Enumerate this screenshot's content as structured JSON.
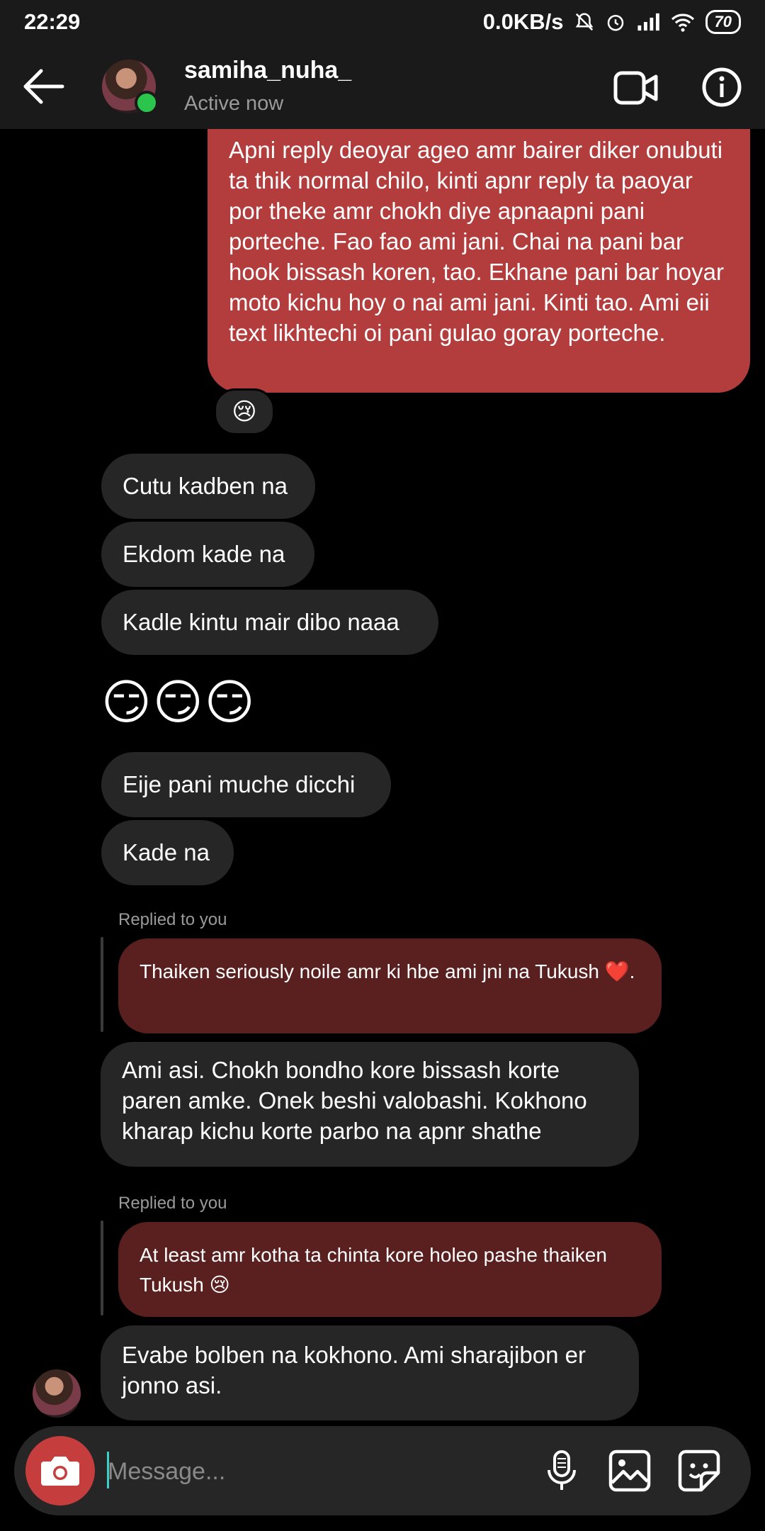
{
  "status_bar": {
    "time": "22:29",
    "network_speed": "0.0KB/s",
    "icons": [
      "mute-icon",
      "alarm-icon",
      "signal-icon",
      "wifi-icon"
    ],
    "battery": "70"
  },
  "header": {
    "username": "samiha_nuha_",
    "status": "Active now",
    "online_color": "#2bc44d"
  },
  "messages": {
    "outgoing_long": "Apni reply deoyar ageo amr bairer diker onubuti ta thik normal chilo, kinti apnr reply ta paoyar por theke amr chokh diye apnaapni pani porteche. Fao fao ami jani. Chai na pani bar hook bissash koren, tao. Ekhane pani bar hoyar moto kichu hoy o nai ami jani. Kinti tao. Ami eii text likhtechi oi pani gulao goray porteche.",
    "reaction": "😢",
    "m1": "Cutu kadben na",
    "m2": "Ekdom kade na",
    "m3": "Kadle kintu mair dibo naaa",
    "emojis": "😏😏😏",
    "m4": "Eije pani muche dicchi",
    "m5": "Kade na",
    "reply1_label": "Replied to you",
    "reply1_quote": "Thaiken seriously noile amr ki hbe ami jni na Tukush ❤️.",
    "m6": "Ami asi. Chokh bondho kore bissash korte paren amke. Onek beshi valobashi. Kokhono kharap kichu korte parbo na apnr shathe",
    "reply2_label": "Replied to you",
    "reply2_quote": "At least amr kotha ta chinta kore holeo pashe thaiken Tukush 😢",
    "m7": "Evabe bolben na kokhono. Ami sharajibon er jonno asi."
  },
  "composer": {
    "placeholder": "Message..."
  },
  "colors": {
    "outgoing_bubble": "#b33c3c",
    "incoming_bubble": "#262626",
    "quote_bubble": "#5a1f1f",
    "camera_button": "#c63d3d",
    "cursor": "#3ad1c6"
  }
}
